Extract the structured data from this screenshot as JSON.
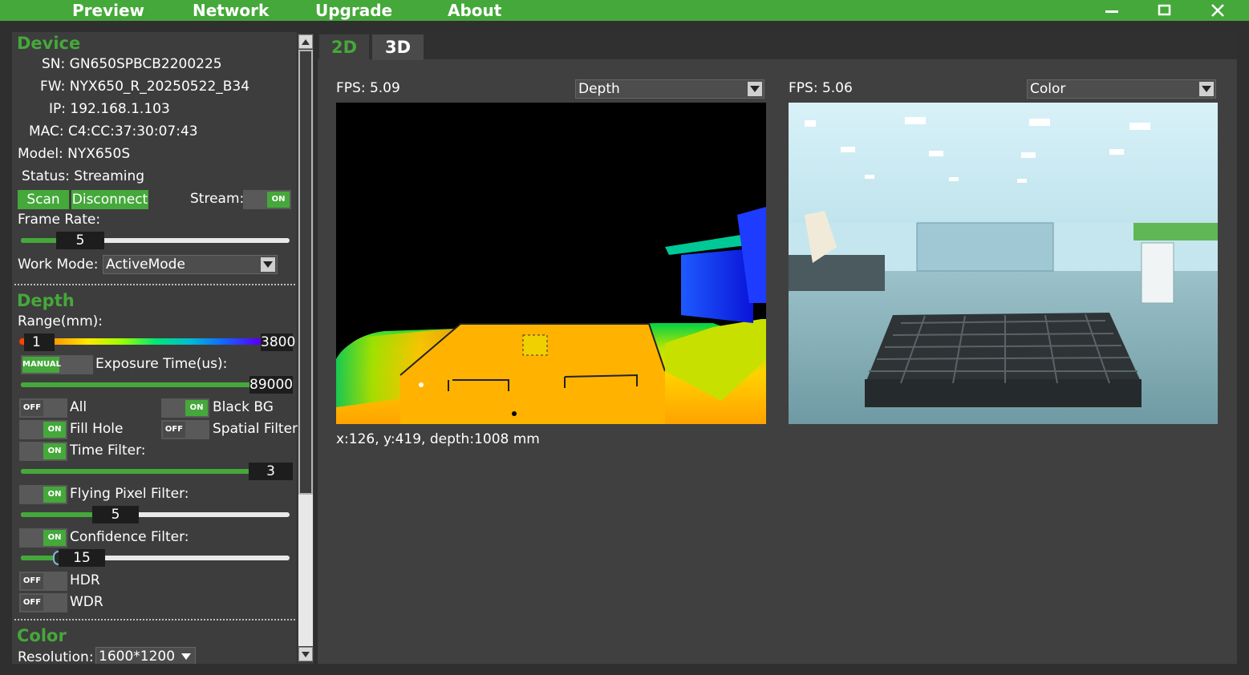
{
  "menu": {
    "preview": "Preview",
    "network": "Network",
    "upgrade": "Upgrade",
    "about": "About"
  },
  "device": {
    "title": "Device",
    "sn": "SN: GN650SPBCB2200225",
    "fw": "FW: NYX650_R_20250522_B34",
    "ip": "IP: 192.168.1.103",
    "mac": "MAC: C4:CC:37:30:07:43",
    "model": "Model: NYX650S",
    "status": "Status: Streaming",
    "scan_label": "Scan",
    "disconnect_label": "Disconnect",
    "stream_label": "Stream:",
    "stream_toggle": "ON",
    "frame_rate_label": "Frame Rate:",
    "frame_rate_value": "5",
    "frame_rate_level": 0.15,
    "work_mode_label": "Work Mode:",
    "work_mode_value": "ActiveMode"
  },
  "depth": {
    "title": "Depth",
    "range_label": "Range(mm):",
    "range_min": "1",
    "range_max": "3800",
    "exposure_toggle": "MANUAL",
    "exposure_label": "Exposure Time(us):",
    "exposure_value": "89000",
    "filters": {
      "all": {
        "label": "All",
        "state": "OFF"
      },
      "black_bg": {
        "label": "Black BG",
        "state": "ON"
      },
      "fill_hole": {
        "label": "Fill Hole",
        "state": "ON"
      },
      "spatial": {
        "label": "Spatial Filter",
        "state": "OFF"
      },
      "time": {
        "label": "Time Filter:",
        "state": "ON",
        "value": "3"
      },
      "flying": {
        "label": "Flying Pixel Filter:",
        "state": "ON",
        "value": "5"
      },
      "confidence": {
        "label": "Confidence Filter:",
        "state": "ON",
        "value": "15"
      },
      "hdr": {
        "label": "HDR",
        "state": "OFF"
      },
      "wdr": {
        "label": "WDR",
        "state": "OFF"
      }
    }
  },
  "color": {
    "title": "Color",
    "resolution_label": "Resolution:",
    "resolution_value": "1600*1200"
  },
  "tabs": {
    "tab_2d": "2D",
    "tab_3d": "3D"
  },
  "views": {
    "left_fps": "FPS: 5.09",
    "left_stream": "Depth",
    "right_fps": "FPS: 5.06",
    "right_stream": "Color",
    "depth_readout": "x:126, y:419, depth:1008 mm"
  },
  "colors": {
    "accent": "#45a83a",
    "background": "#404040"
  }
}
